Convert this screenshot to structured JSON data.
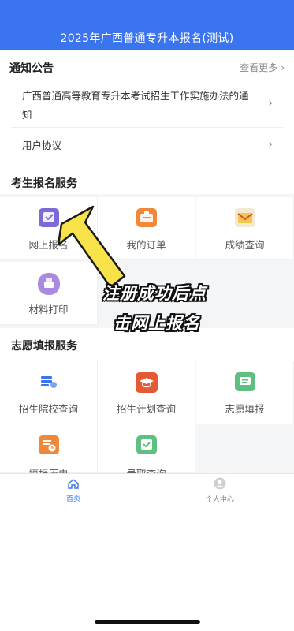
{
  "header": {
    "title": "2025年广西普通专升本报名(测试)"
  },
  "notice": {
    "title": "通知公告",
    "more": "查看更多",
    "items": [
      {
        "text": "广西普通高等教育专升本考试招生工作实施办法的通知"
      },
      {
        "text": "用户协议"
      }
    ]
  },
  "exam_services": {
    "title": "考生报名服务",
    "items": [
      {
        "label": "网上报名",
        "icon": "online-signup-icon"
      },
      {
        "label": "我的订单",
        "icon": "order-icon"
      },
      {
        "label": "成绩查询",
        "icon": "score-query-icon"
      },
      {
        "label": "材料打印",
        "icon": "print-icon"
      }
    ]
  },
  "volunteer_services": {
    "title": "志愿填报服务",
    "items": [
      {
        "label": "招生院校查询",
        "icon": "school-query-icon"
      },
      {
        "label": "招生计划查询",
        "icon": "plan-query-icon"
      },
      {
        "label": "志愿填报",
        "icon": "volunteer-fill-icon"
      },
      {
        "label": "填报历史",
        "icon": "history-icon"
      },
      {
        "label": "录取查询",
        "icon": "admission-query-icon"
      }
    ]
  },
  "annotation": {
    "line1": "注册成功后点",
    "line2": "击网上报名"
  },
  "tabbar": {
    "items": [
      {
        "label": "首页",
        "icon": "home-icon",
        "active": true
      },
      {
        "label": "个人中心",
        "icon": "profile-icon",
        "active": false
      }
    ]
  },
  "colors": {
    "primary": "#3a74ee",
    "page_bg": "#f4f5f7"
  }
}
